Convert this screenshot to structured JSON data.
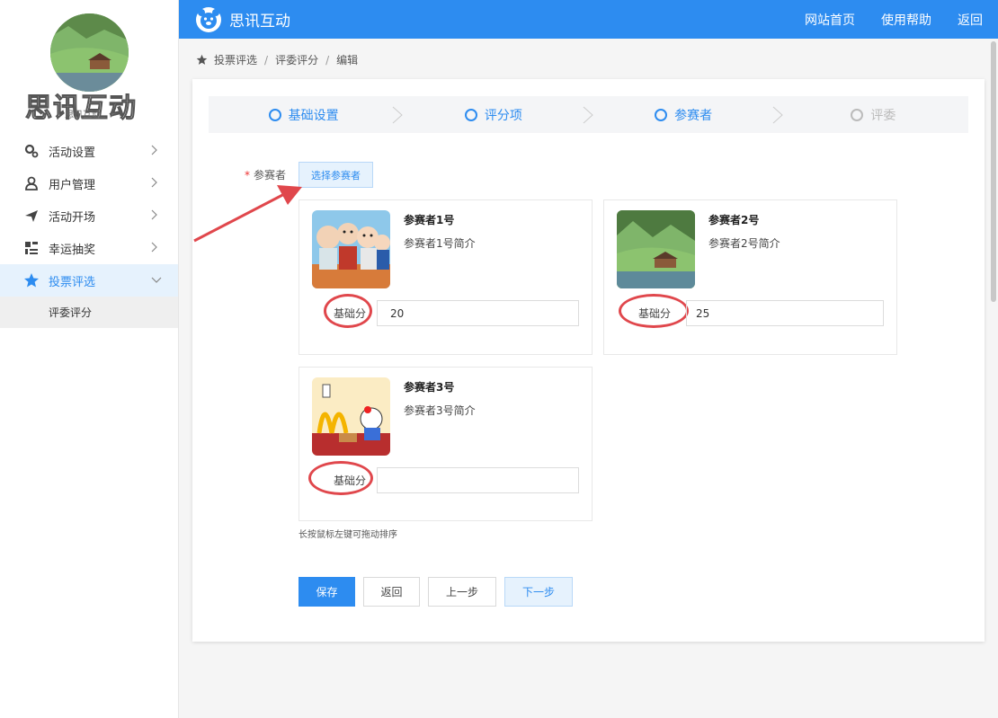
{
  "brand": {
    "text": "思讯互动",
    "sub": "思讯互动"
  },
  "header": {
    "title": "思讯互动",
    "links": [
      "网站首页",
      "使用帮助",
      "返回"
    ]
  },
  "sidebar": {
    "items": [
      {
        "label": "活动设置",
        "icon": "gears-icon"
      },
      {
        "label": "用户管理",
        "icon": "user-icon"
      },
      {
        "label": "活动开场",
        "icon": "paper-plane-icon"
      },
      {
        "label": "幸运抽奖",
        "icon": "barcode-icon"
      },
      {
        "label": "投票评选",
        "icon": "star-icon",
        "active": true
      }
    ],
    "sub_item": "评委评分"
  },
  "breadcrumb": [
    "投票评选",
    "评委评分",
    "编辑"
  ],
  "steps": [
    {
      "label": "基础设置",
      "state": "active"
    },
    {
      "label": "评分项",
      "state": "active"
    },
    {
      "label": "参赛者",
      "state": "active"
    },
    {
      "label": "评委",
      "state": "disabled"
    }
  ],
  "form": {
    "participant_label": "参赛者",
    "select_button": "选择参赛者",
    "hint": "长按鼠标左键可拖动排序"
  },
  "participants": [
    {
      "name": "参赛者1号",
      "desc": "参赛者1号简介",
      "score_label": "基础分",
      "score": "20"
    },
    {
      "name": "参赛者2号",
      "desc": "参赛者2号简介",
      "score_label": "基础分",
      "score": "25"
    },
    {
      "name": "参赛者3号",
      "desc": "参赛者3号简介",
      "score_label": "基础分",
      "score": ""
    }
  ],
  "buttons": {
    "save": "保存",
    "back": "返回",
    "prev": "上一步",
    "next": "下一步"
  },
  "colors": {
    "primary": "#2d8cf0",
    "annotation": "#e0474c"
  }
}
